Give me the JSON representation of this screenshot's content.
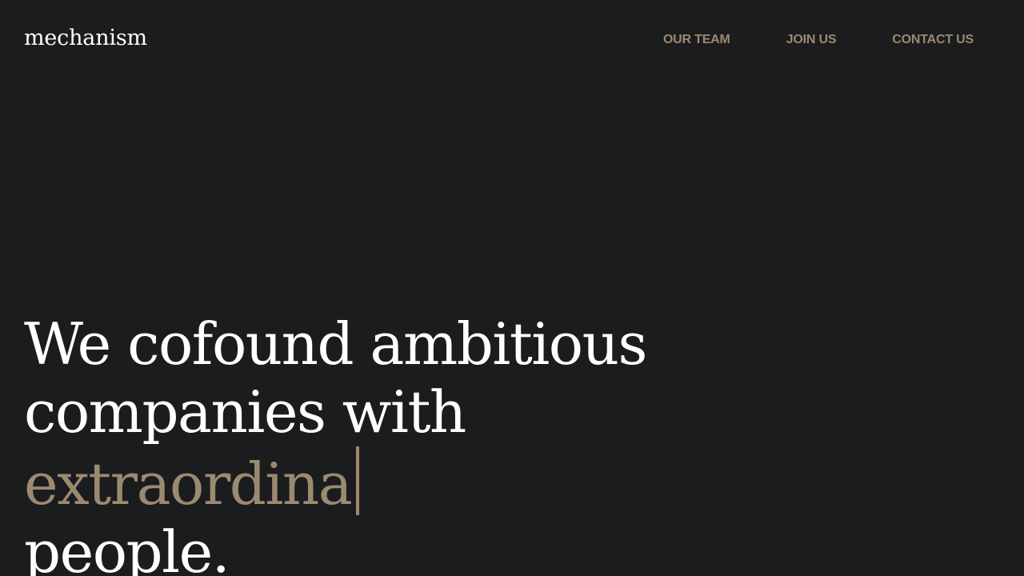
{
  "header": {
    "logo": "mechanism",
    "nav": [
      {
        "label": "OUR TEAM"
      },
      {
        "label": "JOIN US"
      },
      {
        "label": "CONTACT US"
      }
    ]
  },
  "hero": {
    "line1": "We cofound ambitious",
    "line2": "companies with",
    "typed_word": "extraordina",
    "line4": "people."
  },
  "colors": {
    "background": "#1b1c1e",
    "text": "#ffffff",
    "accent": "#9b8a70"
  }
}
